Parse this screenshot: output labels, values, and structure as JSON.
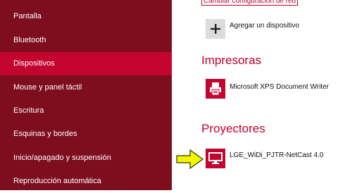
{
  "sidebar": {
    "items": [
      {
        "label": "Pantalla"
      },
      {
        "label": "Bluetooth"
      },
      {
        "label": "Dispositivos"
      },
      {
        "label": "Mouse y panel táctil"
      },
      {
        "label": "Escritura"
      },
      {
        "label": "Esquinas y bordes"
      },
      {
        "label": "Inicio/apagado y suspensión"
      },
      {
        "label": "Reproducción automática"
      }
    ],
    "selected": "Dispositivos"
  },
  "main": {
    "network_link": "Cambiar configuración de red",
    "add_device_label": "Agregar un dispositivo",
    "printers_header": "Impresoras",
    "printer_name": "Microsoft XPS Document Writer",
    "projectors_header": "Proyectores",
    "projector_name": "LGE_WiDi_PJTR-NetCast 4.0"
  },
  "icons": {
    "add": "plus-icon",
    "printer": "printer-document-icon",
    "projector": "monitor-icon",
    "pointer": "yellow-arrow-icon"
  },
  "colors": {
    "sidebar_bg": "#7e0d1e",
    "selected_bg": "#c2042f",
    "accent": "#c0002e",
    "arrow": "#f5f500"
  }
}
